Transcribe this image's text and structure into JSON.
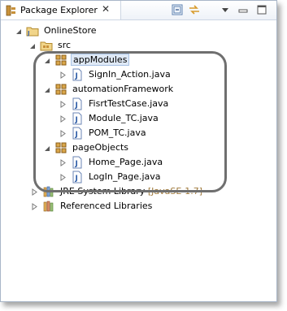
{
  "view": {
    "title": "Package Explorer",
    "close_glyph": "✕",
    "toolbar": [
      {
        "name": "collapse-all-icon"
      },
      {
        "name": "link-with-editor-icon"
      },
      {
        "name": "view-menu-icon"
      },
      {
        "name": "minimize-icon"
      },
      {
        "name": "maximize-icon"
      }
    ]
  },
  "tree": {
    "project": "OnlineStore",
    "src": "src",
    "packages": [
      {
        "label": "appModules",
        "files": [
          "SignIn_Action.java"
        ]
      },
      {
        "label": "automationFramework",
        "files": [
          "FisrtTestCase.java",
          "Module_TC.java",
          "POM_TC.java"
        ]
      },
      {
        "label": "pageObjects",
        "files": [
          "Home_Page.java",
          "LogIn_Page.java"
        ]
      }
    ],
    "jre": {
      "label": "JRE System Library",
      "decoration": "[JavaSE-1.7]"
    },
    "referenced": "Referenced Libraries"
  },
  "colors": {
    "selection_bg": "#dfe9f6",
    "highlight_outline": "#6f6f6f",
    "decoration": "#a07a3c"
  }
}
